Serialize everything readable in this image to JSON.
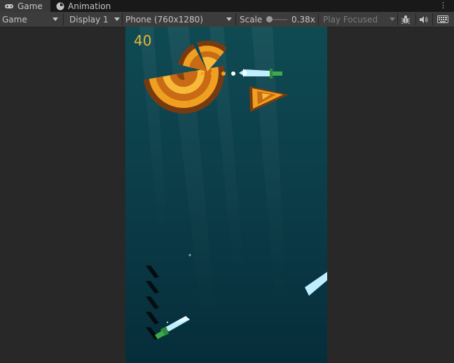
{
  "tabs": [
    {
      "label": "Game",
      "icon": "gamepad-icon"
    },
    {
      "label": "Animation",
      "icon": "animation-icon"
    }
  ],
  "toolbar": {
    "view_select": "Game",
    "display_select": "Display 1",
    "resolution_select": "Phone (760x1280)",
    "scale_label": "Scale",
    "scale_value": "0.38x",
    "play_mode_select": "Play Focused",
    "scale_fraction": 0.1
  },
  "game": {
    "score": "40",
    "knives_remaining": 5,
    "colors": {
      "score": "#e8b834",
      "background_top": "#0f4a53",
      "background_bottom": "#062d3a"
    }
  }
}
